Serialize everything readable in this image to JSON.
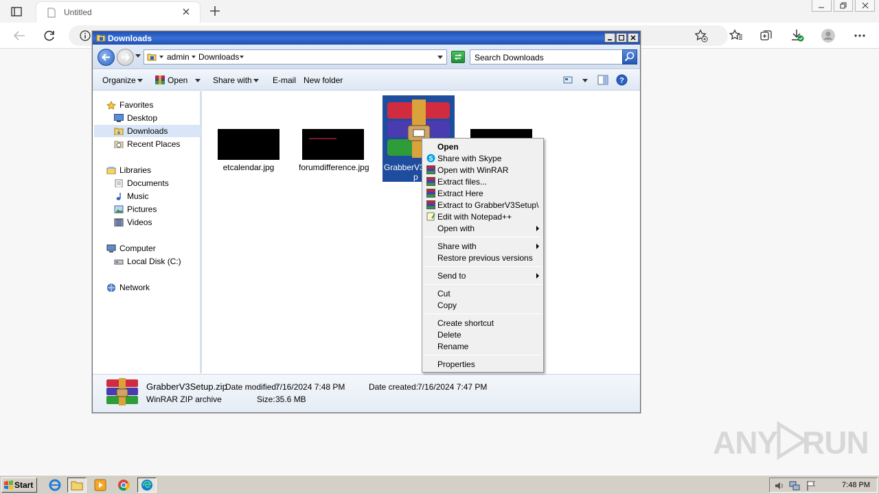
{
  "browser": {
    "tab_title": "Untitled"
  },
  "explorer": {
    "title": "Downloads",
    "breadcrumb": [
      "admin",
      "Downloads"
    ],
    "search_placeholder": "Search Downloads",
    "commands": {
      "organize": "Organize",
      "open": "Open",
      "share_with": "Share with",
      "email": "E-mail",
      "new_folder": "New folder"
    },
    "nav": {
      "favorites": "Favorites",
      "desktop": "Desktop",
      "downloads": "Downloads",
      "recent_places": "Recent Places",
      "libraries": "Libraries",
      "documents": "Documents",
      "music": "Music",
      "pictures": "Pictures",
      "videos": "Videos",
      "computer": "Computer",
      "local_disk": "Local Disk (C:)",
      "network": "Network"
    },
    "files": [
      {
        "name": "etcalendar.jpg"
      },
      {
        "name": "forumdifference.jpg"
      },
      {
        "name": "GrabberV3Setup.zip",
        "name_partial": "GrabberV3",
        "name_line2": "p"
      },
      {
        "name": ""
      }
    ],
    "details": {
      "name": "GrabberV3Setup.zip",
      "type": "WinRAR ZIP archive",
      "date_modified_label": "Date modified:",
      "date_modified": "7/16/2024 7:48 PM",
      "date_created_label": "Date created:",
      "date_created": "7/16/2024 7:47 PM",
      "size_label": "Size:",
      "size": "35.6 MB"
    }
  },
  "context_menu": {
    "items": [
      {
        "label": "Open"
      },
      {
        "label": "Share with Skype"
      },
      {
        "label": "Open with WinRAR"
      },
      {
        "label": "Extract files..."
      },
      {
        "label": "Extract Here"
      },
      {
        "label": "Extract to GrabberV3Setup\\"
      },
      {
        "label": "Edit with Notepad++"
      },
      {
        "label": "Open with"
      },
      {
        "label": "Share with"
      },
      {
        "label": "Restore previous versions"
      },
      {
        "label": "Send to"
      },
      {
        "label": "Cut"
      },
      {
        "label": "Copy"
      },
      {
        "label": "Create shortcut"
      },
      {
        "label": "Delete"
      },
      {
        "label": "Rename"
      },
      {
        "label": "Properties"
      }
    ]
  },
  "taskbar": {
    "start": "Start",
    "clock": "7:48 PM"
  },
  "watermark": {
    "text_left": "ANY",
    "text_right": "RUN"
  },
  "colors": {
    "title_bar": "#1f52b7",
    "selection": "#1f4d9e",
    "menu_bg": "#f0f0f0"
  }
}
